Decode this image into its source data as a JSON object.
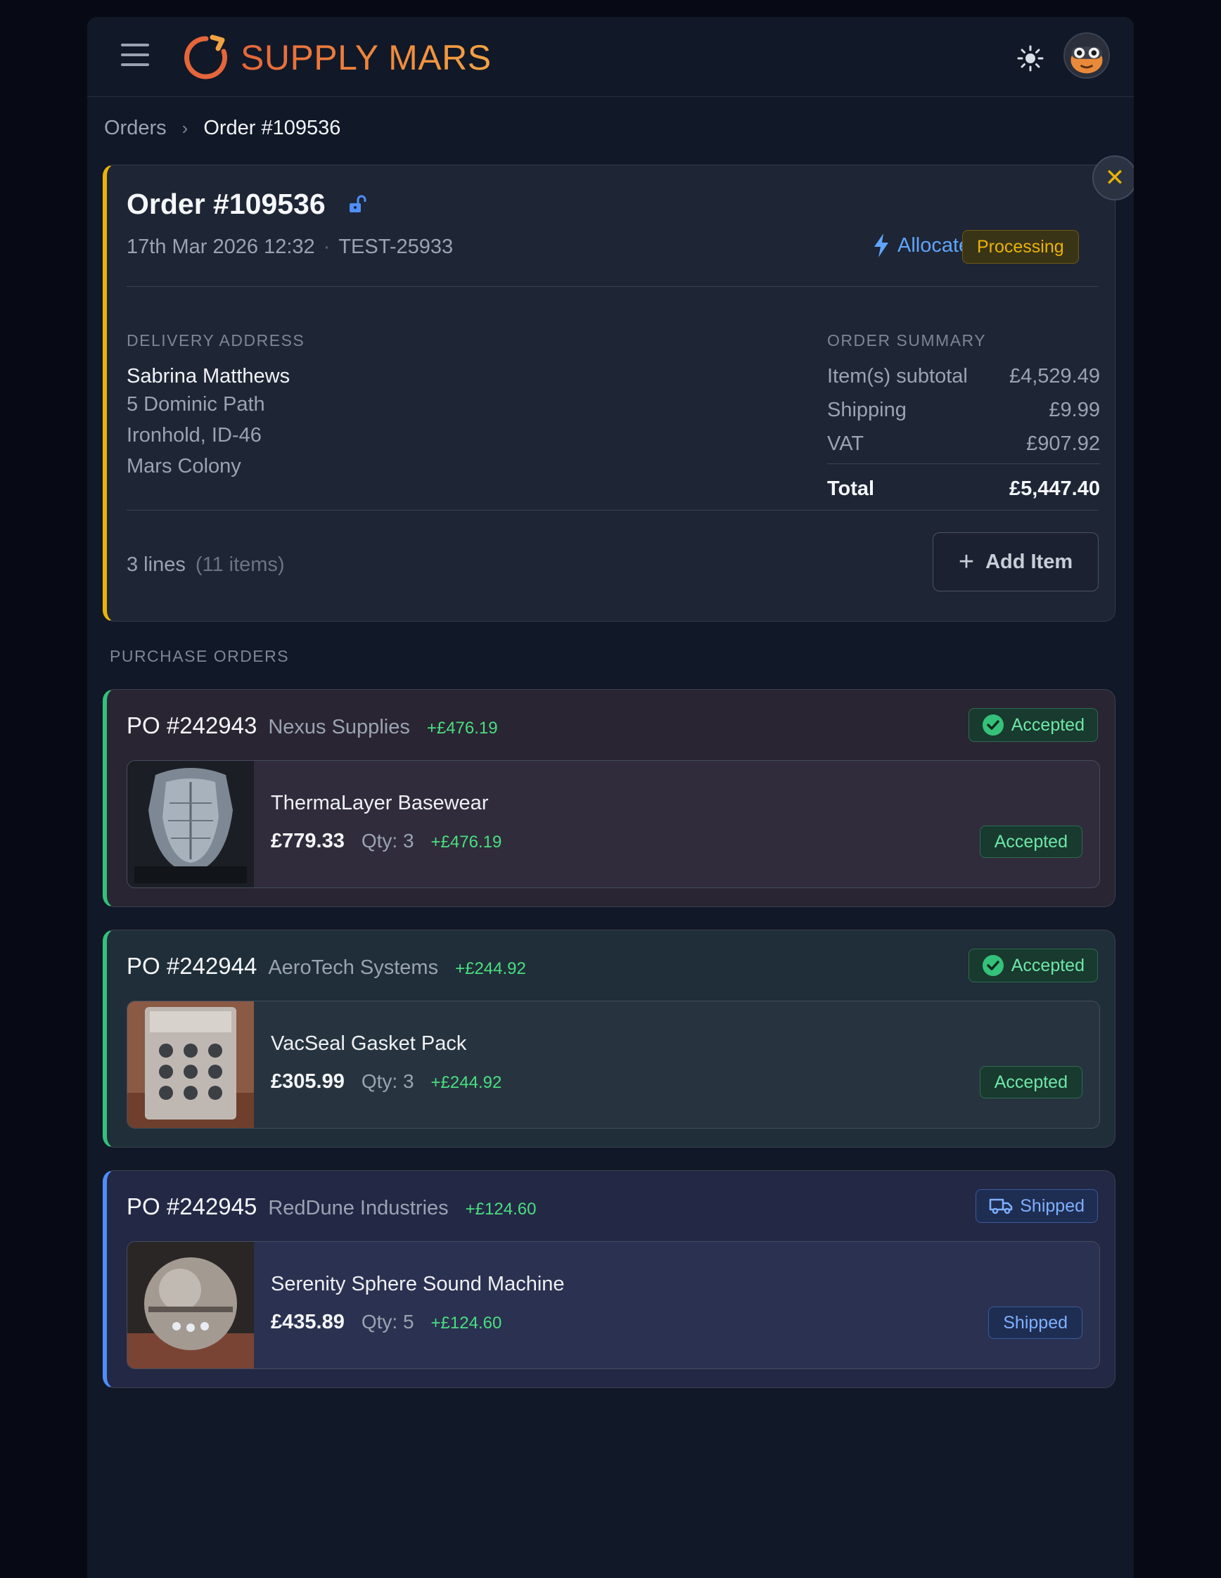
{
  "header": {
    "brand": "SUPPLY MARS",
    "menu_icon": "hamburger-icon",
    "theme_icon": "sun-icon",
    "avatar_icon": "robot-avatar"
  },
  "breadcrumb": {
    "parent": "Orders",
    "current": "Order #109536"
  },
  "order": {
    "title": "Order #109536",
    "date": "17th Mar 2026 12:32",
    "reference": "TEST-25933",
    "allocate_label": "Allocate",
    "status": "Processing",
    "delivery_label": "DELIVERY ADDRESS",
    "address": {
      "name": "Sabrina Matthews",
      "line1": "5 Dominic Path",
      "line2": "Ironhold, ID-46",
      "line3": "Mars Colony"
    },
    "summary_label": "ORDER SUMMARY",
    "summary": {
      "subtotal_label": "Item(s) subtotal",
      "subtotal": "£4,529.49",
      "shipping_label": "Shipping",
      "shipping": "£9.99",
      "vat_label": "VAT",
      "vat": "£907.92",
      "total_label": "Total",
      "total": "£5,447.40"
    },
    "lines": "3 lines",
    "items": "(11 items)",
    "add_item_label": "Add Item"
  },
  "purchase_orders_label": "PURCHASE ORDERS",
  "purchase_orders": [
    {
      "number": "PO #242943",
      "vendor": "Nexus Supplies",
      "profit": "+£476.19",
      "status": "Accepted",
      "item": {
        "name": "ThermaLayer Basewear",
        "price": "£779.33",
        "qty": "Qty: 3",
        "profit": "+£476.19",
        "status": "Accepted"
      }
    },
    {
      "number": "PO #242944",
      "vendor": "AeroTech Systems",
      "profit": "+£244.92",
      "status": "Accepted",
      "item": {
        "name": "VacSeal Gasket Pack",
        "price": "£305.99",
        "qty": "Qty: 3",
        "profit": "+£244.92",
        "status": "Accepted"
      }
    },
    {
      "number": "PO #242945",
      "vendor": "RedDune Industries",
      "profit": "+£124.60",
      "status": "Shipped",
      "item": {
        "name": "Serenity Sphere Sound Machine",
        "price": "£435.89",
        "qty": "Qty: 5",
        "profit": "+£124.60",
        "status": "Shipped"
      }
    }
  ],
  "colors": {
    "accent_orange": "#ef7a3a",
    "processing": "#eab308",
    "accepted": "#4ade80",
    "shipped": "#60a5fa"
  }
}
